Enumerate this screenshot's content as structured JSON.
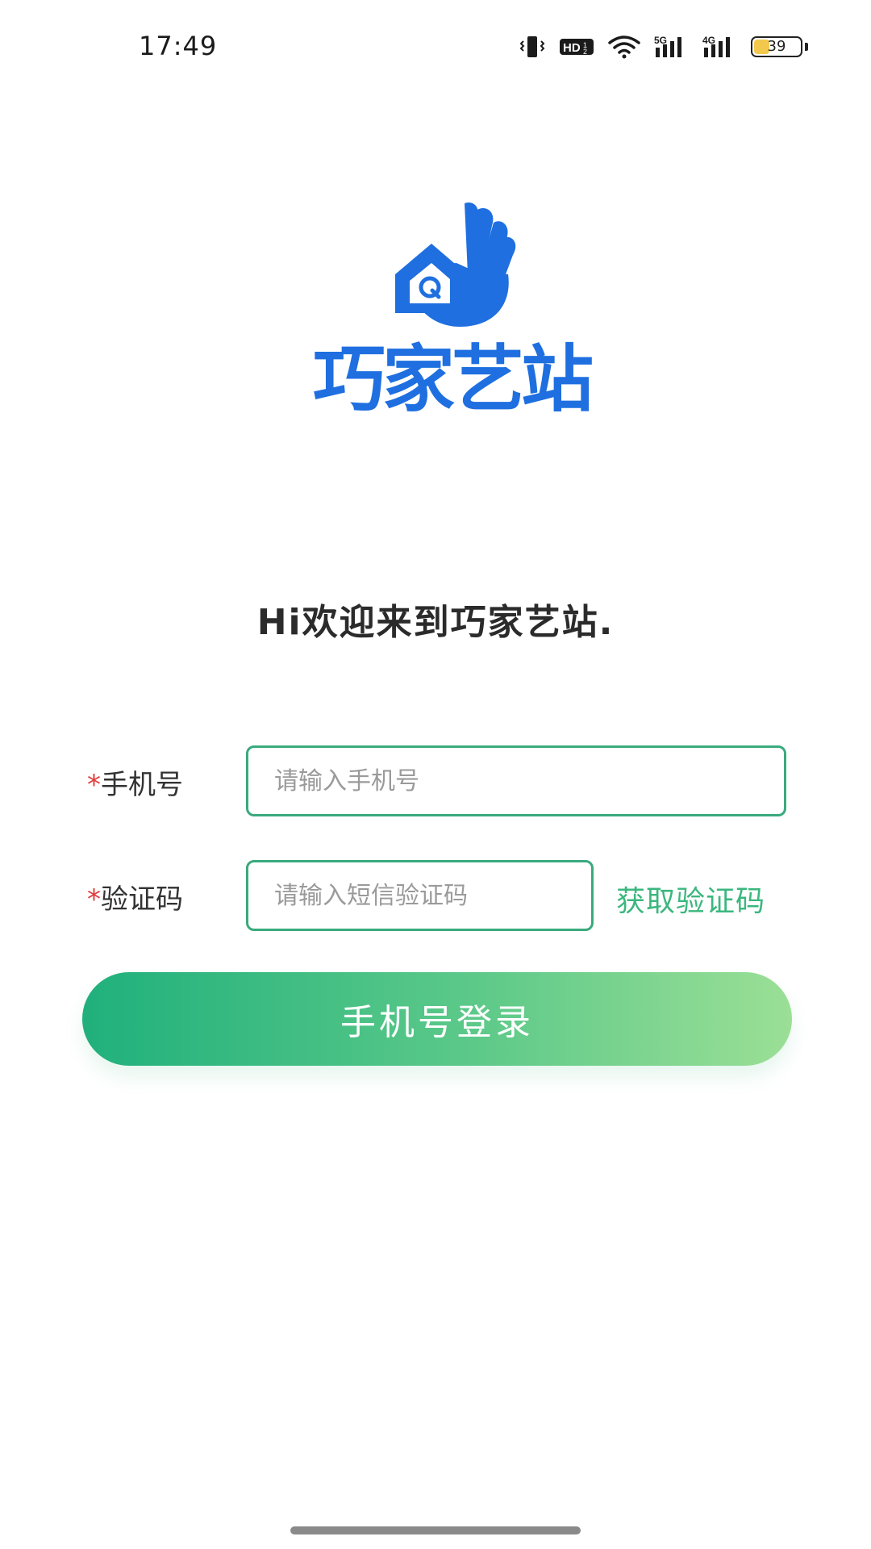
{
  "status_bar": {
    "time": "17:49",
    "battery_level": "39",
    "network_1": "5G",
    "network_2": "4G",
    "hd_badge": "HD",
    "icons": [
      "vibrate-icon",
      "hd-voice-icon",
      "wifi-icon",
      "signal-5g-icon",
      "signal-4g-icon",
      "battery-icon"
    ]
  },
  "logo": {
    "text": "巧家艺站",
    "color": "#1f6fe0"
  },
  "welcome_text": "Hi欢迎来到巧家艺站.",
  "form": {
    "phone": {
      "required_mark": "*",
      "label": "手机号",
      "placeholder": "请输入手机号",
      "value": ""
    },
    "code": {
      "required_mark": "*",
      "label": "验证码",
      "placeholder": "请输入短信验证码",
      "value": ""
    },
    "get_code_label": "获取验证码",
    "login_label": "手机号登录"
  },
  "colors": {
    "accent": "#3bb77e",
    "required": "#e03c3c",
    "button_gradient_start": "#20b07c",
    "button_gradient_end": "#9bdf96"
  }
}
